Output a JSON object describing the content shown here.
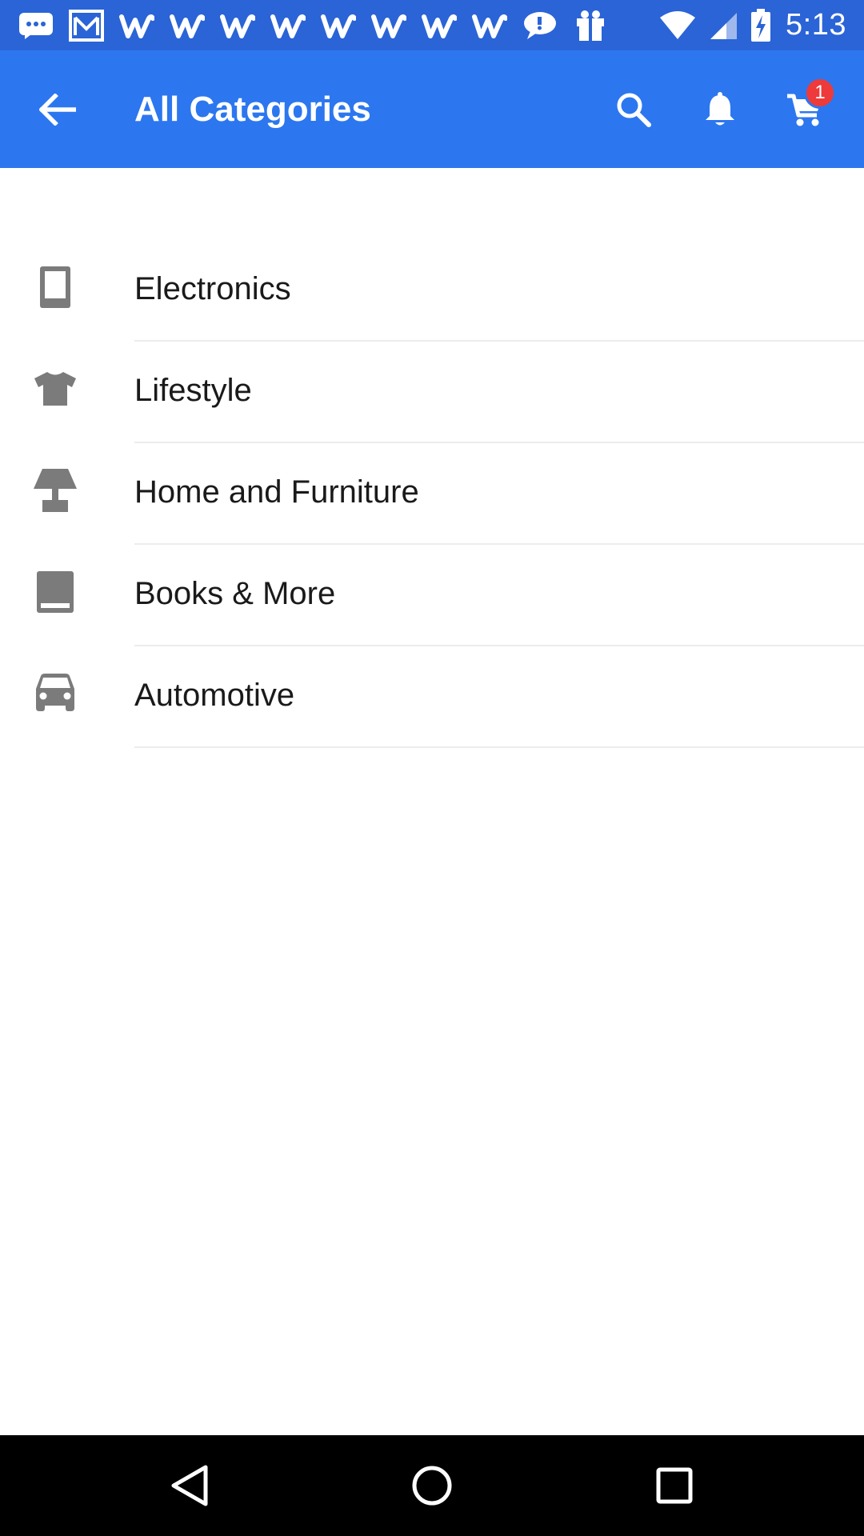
{
  "status_bar": {
    "time": "5:13",
    "notification_icons": [
      "messages-icon",
      "gmail-icon",
      "w-app-icon",
      "w-app-icon",
      "w-app-icon",
      "w-app-icon",
      "w-app-icon",
      "w-app-icon",
      "w-app-icon",
      "w-app-icon",
      "chat-bubble-icon",
      "gift-box-icon"
    ],
    "system_icons": [
      "wifi-icon",
      "cell-signal-icon",
      "battery-charging-icon"
    ]
  },
  "app_bar": {
    "title": "All Categories",
    "cart_badge": "1",
    "colors": {
      "background": "#2c77ef",
      "status_bar": "#2a64d6",
      "badge": "#ee3a3a"
    }
  },
  "categories": [
    {
      "label": "Electronics",
      "icon": "phone-icon"
    },
    {
      "label": "Lifestyle",
      "icon": "tshirt-icon"
    },
    {
      "label": "Home and Furniture",
      "icon": "lamp-icon"
    },
    {
      "label": "Books & More",
      "icon": "book-icon"
    },
    {
      "label": "Automotive",
      "icon": "car-icon"
    }
  ],
  "nav_bar": {
    "buttons": [
      "back-triangle-icon",
      "home-circle-icon",
      "recents-square-icon"
    ]
  }
}
